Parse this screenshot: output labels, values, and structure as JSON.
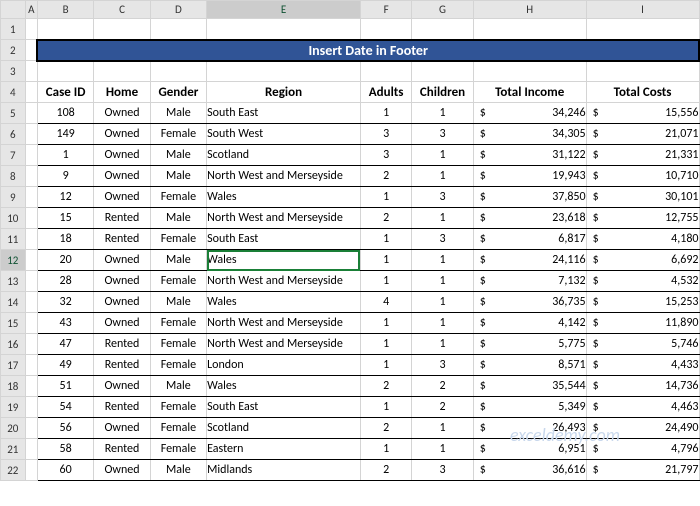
{
  "title": "Insert Date in Footer",
  "watermark": "exceldemy.com",
  "col_letters": [
    "A",
    "B",
    "C",
    "D",
    "E",
    "F",
    "G",
    "H",
    "I"
  ],
  "row_numbers": [
    "1",
    "2",
    "3",
    "4",
    "5",
    "6",
    "7",
    "8",
    "9",
    "10",
    "11",
    "12",
    "13",
    "14",
    "15",
    "16",
    "17",
    "18",
    "19",
    "20",
    "21",
    "22"
  ],
  "headers": {
    "case_id": "Case ID",
    "home": "Home",
    "gender": "Gender",
    "region": "Region",
    "adults": "Adults",
    "children": "Children",
    "total_income": "Total Income",
    "total_costs": "Total Costs"
  },
  "selected_cell": {
    "row": 12,
    "col": "E",
    "value": "Wales"
  },
  "currency_symbol": "$",
  "chart_data": {
    "type": "table",
    "title": "Insert Date in Footer",
    "columns": [
      "Case ID",
      "Home",
      "Gender",
      "Region",
      "Adults",
      "Children",
      "Total Income",
      "Total Costs"
    ],
    "rows": [
      {
        "case_id": 108,
        "home": "Owned",
        "gender": "Male",
        "region": "South East",
        "adults": 1,
        "children": 1,
        "total_income": 34246,
        "total_costs": 15556
      },
      {
        "case_id": 149,
        "home": "Owned",
        "gender": "Female",
        "region": "South West",
        "adults": 3,
        "children": 3,
        "total_income": 34305,
        "total_costs": 21071
      },
      {
        "case_id": 1,
        "home": "Owned",
        "gender": "Male",
        "region": "Scotland",
        "adults": 3,
        "children": 1,
        "total_income": 31122,
        "total_costs": 21331
      },
      {
        "case_id": 9,
        "home": "Owned",
        "gender": "Male",
        "region": "North West and Merseyside",
        "adults": 2,
        "children": 1,
        "total_income": 19943,
        "total_costs": 10710
      },
      {
        "case_id": 12,
        "home": "Owned",
        "gender": "Female",
        "region": "Wales",
        "adults": 1,
        "children": 3,
        "total_income": 37850,
        "total_costs": 30101
      },
      {
        "case_id": 15,
        "home": "Rented",
        "gender": "Male",
        "region": "North West and Merseyside",
        "adults": 2,
        "children": 1,
        "total_income": 23618,
        "total_costs": 12755
      },
      {
        "case_id": 18,
        "home": "Rented",
        "gender": "Female",
        "region": "South East",
        "adults": 1,
        "children": 3,
        "total_income": 6817,
        "total_costs": 4180
      },
      {
        "case_id": 20,
        "home": "Owned",
        "gender": "Male",
        "region": "Wales",
        "adults": 1,
        "children": 1,
        "total_income": 24116,
        "total_costs": 6692
      },
      {
        "case_id": 28,
        "home": "Owned",
        "gender": "Female",
        "region": "North West and Merseyside",
        "adults": 1,
        "children": 1,
        "total_income": 7132,
        "total_costs": 4532
      },
      {
        "case_id": 32,
        "home": "Owned",
        "gender": "Male",
        "region": "Wales",
        "adults": 4,
        "children": 1,
        "total_income": 36735,
        "total_costs": 15253
      },
      {
        "case_id": 43,
        "home": "Owned",
        "gender": "Female",
        "region": "North West and Merseyside",
        "adults": 1,
        "children": 1,
        "total_income": 4142,
        "total_costs": 11890
      },
      {
        "case_id": 47,
        "home": "Rented",
        "gender": "Female",
        "region": "North West and Merseyside",
        "adults": 1,
        "children": 1,
        "total_income": 5775,
        "total_costs": 5746
      },
      {
        "case_id": 49,
        "home": "Rented",
        "gender": "Female",
        "region": "London",
        "adults": 1,
        "children": 3,
        "total_income": 8571,
        "total_costs": 4433
      },
      {
        "case_id": 51,
        "home": "Owned",
        "gender": "Male",
        "region": "Wales",
        "adults": 2,
        "children": 2,
        "total_income": 35544,
        "total_costs": 14736
      },
      {
        "case_id": 54,
        "home": "Rented",
        "gender": "Female",
        "region": "South East",
        "adults": 1,
        "children": 2,
        "total_income": 5349,
        "total_costs": 4463
      },
      {
        "case_id": 56,
        "home": "Owned",
        "gender": "Female",
        "region": "Scotland",
        "adults": 2,
        "children": 1,
        "total_income": 26493,
        "total_costs": 24490
      },
      {
        "case_id": 58,
        "home": "Rented",
        "gender": "Female",
        "region": "Eastern",
        "adults": 1,
        "children": 1,
        "total_income": 6951,
        "total_costs": 4796
      },
      {
        "case_id": 60,
        "home": "Owned",
        "gender": "Male",
        "region": "Midlands",
        "adults": 2,
        "children": 3,
        "total_income": 36616,
        "total_costs": 21797
      }
    ]
  }
}
